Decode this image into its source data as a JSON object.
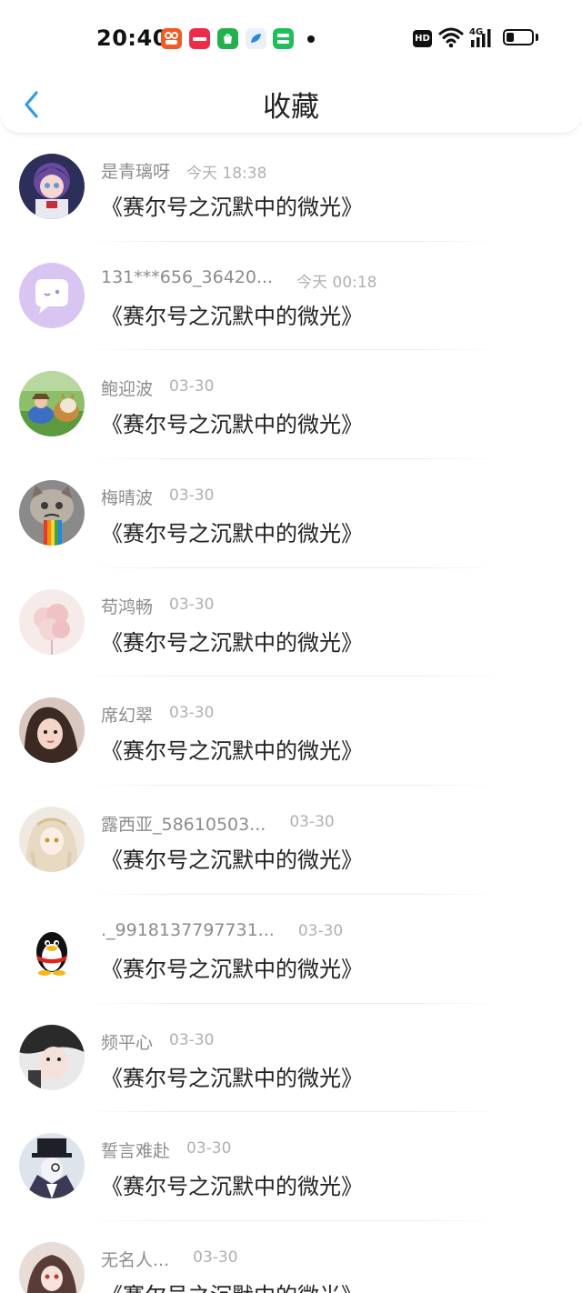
{
  "status_bar": {
    "time": "20:40",
    "hd": "HD",
    "network": "4G",
    "battery_level": 0.3
  },
  "header": {
    "title": "收藏",
    "back_icon": "chevron-left-icon",
    "accent_color": "#2f9bf0"
  },
  "favorites": [
    {
      "user": "是青璃呀",
      "time": "今天 18:38",
      "title": "《赛尔号之沉默中的微光》"
    },
    {
      "user": "131***656_36420...",
      "time": "今天 00:18",
      "title": "《赛尔号之沉默中的微光》"
    },
    {
      "user": "鲍迎波",
      "time": "03-30",
      "title": "《赛尔号之沉默中的微光》"
    },
    {
      "user": "梅晴波",
      "time": "03-30",
      "title": "《赛尔号之沉默中的微光》"
    },
    {
      "user": "苟鸿畅",
      "time": "03-30",
      "title": "《赛尔号之沉默中的微光》"
    },
    {
      "user": "席幻翠",
      "time": "03-30",
      "title": "《赛尔号之沉默中的微光》"
    },
    {
      "user": "露西亚_58610503...",
      "time": "03-30",
      "title": "《赛尔号之沉默中的微光》"
    },
    {
      "user": "._9918137797731...",
      "time": "03-30",
      "title": "《赛尔号之沉默中的微光》"
    },
    {
      "user": "频平心",
      "time": "03-30",
      "title": "《赛尔号之沉默中的微光》"
    },
    {
      "user": "誓言难赴",
      "time": "03-30",
      "title": "《赛尔号之沉默中的微光》"
    },
    {
      "user": "无名人...",
      "time": "03-30",
      "title": "《赛尔号之沉默中的微光》"
    }
  ]
}
